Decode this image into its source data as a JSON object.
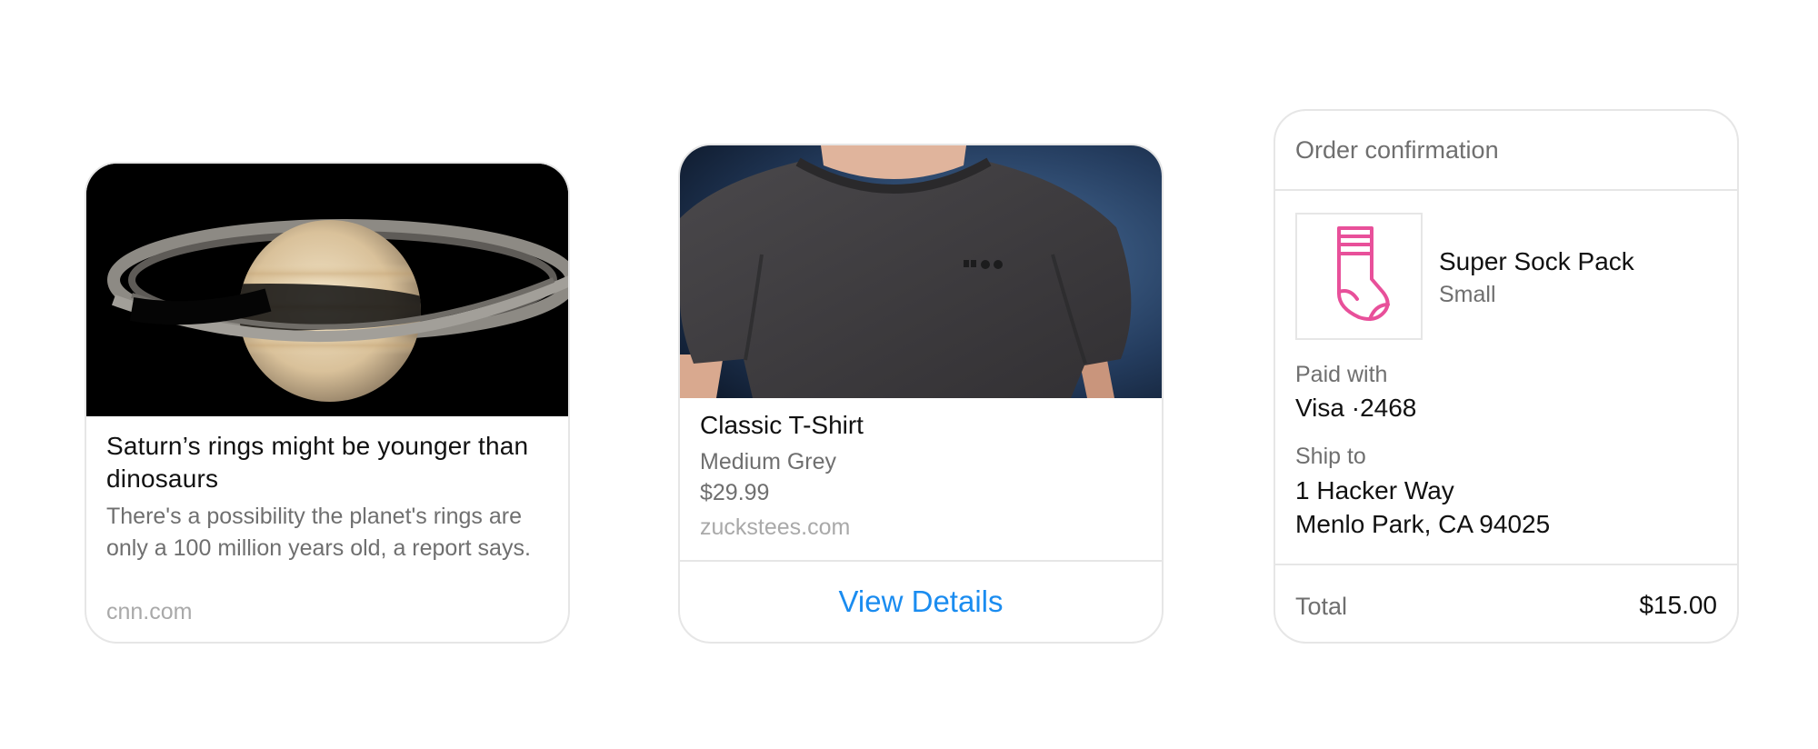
{
  "article_card": {
    "image": "saturn-photo",
    "title": "Saturn’s rings might be younger than dinosaurs",
    "description": "There's a possibility the planet's rings are only a 100 million years old, a report says.",
    "source": "cnn.com"
  },
  "product_card": {
    "image": "tshirt-photo",
    "title": "Classic T-Shirt",
    "subtitle": "Medium Grey",
    "price": "$29.99",
    "source": "zuckstees.com",
    "action_label": "View Details",
    "action_color": "#1a8cf0"
  },
  "receipt_card": {
    "header": "Order confirmation",
    "item_icon": "sock-icon",
    "item_icon_color": "#e8509a",
    "item_name": "Super Sock Pack",
    "item_variant": "Small",
    "paid_label": "Paid with",
    "paid_value": "Visa ·2468",
    "ship_label": "Ship to",
    "ship_line1": "1 Hacker Way",
    "ship_line2": "Menlo Park, CA 94025",
    "total_label": "Total",
    "total_value": "$15.00"
  }
}
